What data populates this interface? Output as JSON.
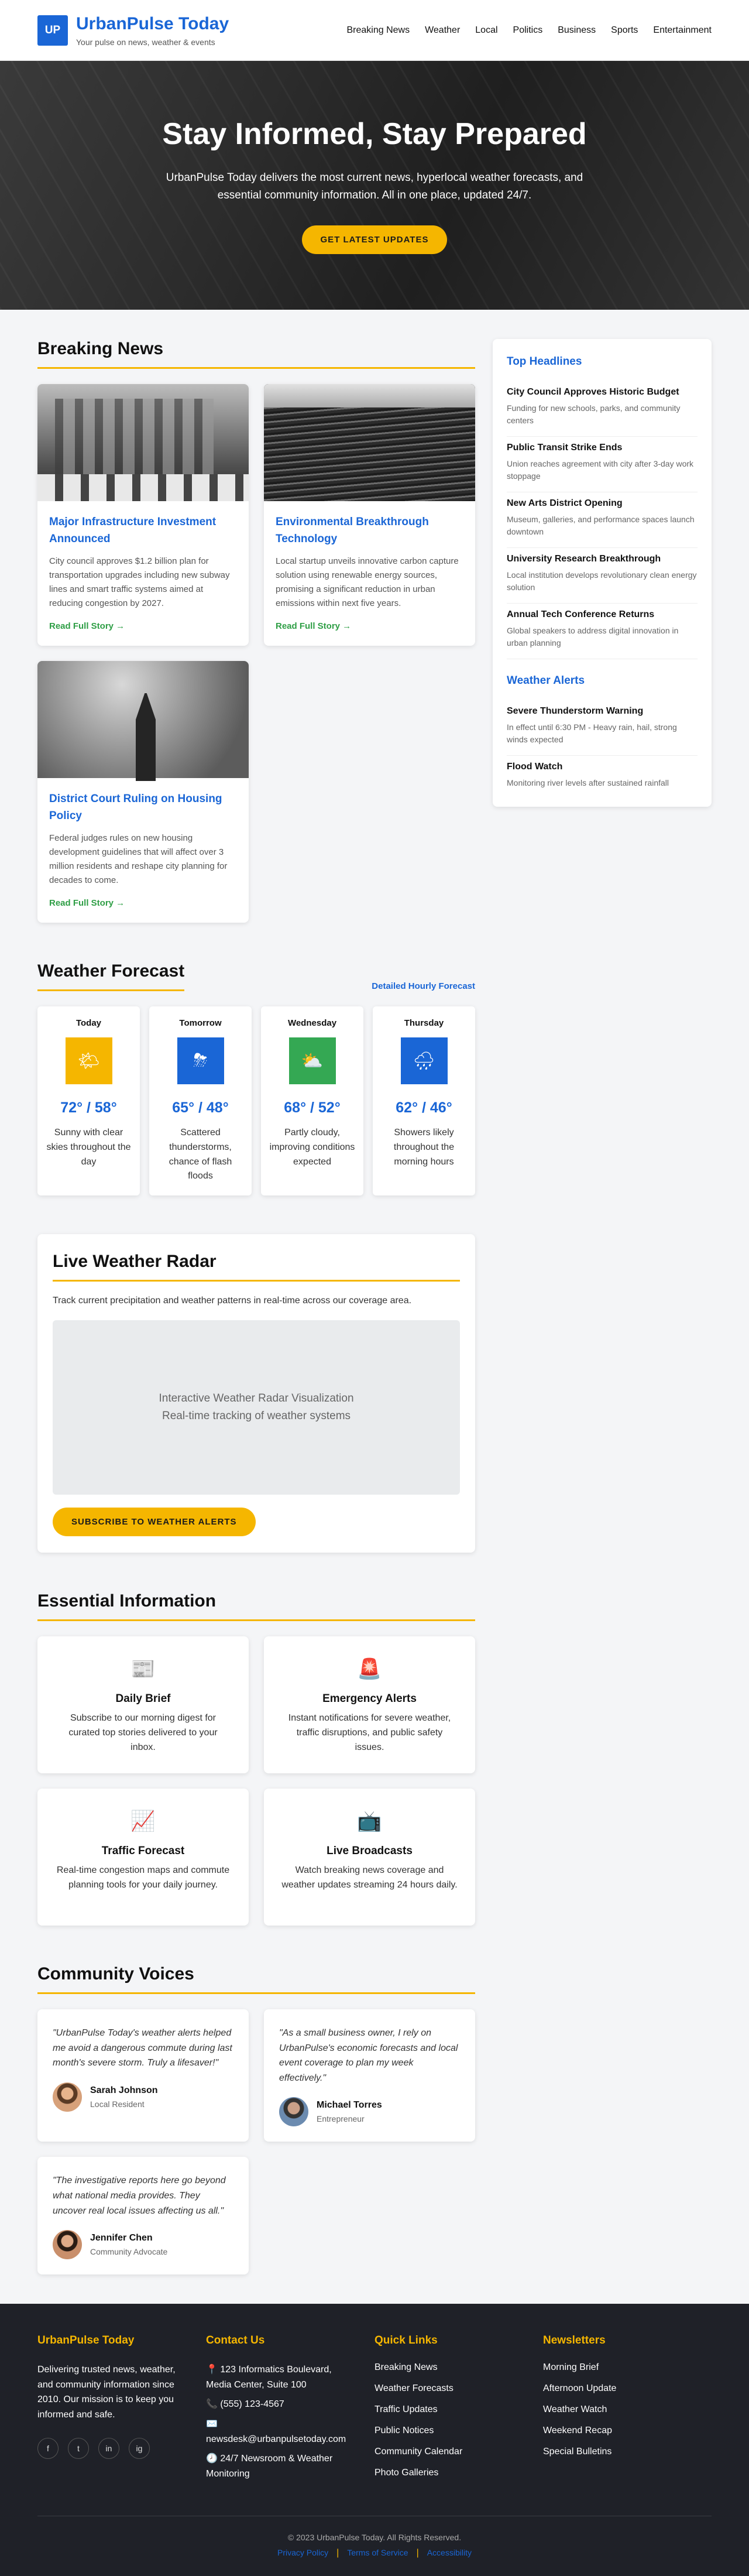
{
  "header": {
    "logo": "UP",
    "brand": "UrbanPulse Today",
    "tagline": "Your pulse on news, weather & events",
    "nav": [
      "Breaking News",
      "Weather",
      "Local",
      "Politics",
      "Business",
      "Sports",
      "Entertainment"
    ]
  },
  "hero": {
    "title": "Stay Informed, Stay Prepared",
    "subtitle": "UrbanPulse Today delivers the most current news, hyperlocal weather forecasts, and essential community information. All in one place, updated 24/7.",
    "cta": "Get Latest Updates"
  },
  "breaking": {
    "title": "Breaking News",
    "stories": [
      {
        "title": "Major Infrastructure Investment Announced",
        "text": "City council approves $1.2 billion plan for transportation upgrades including new subway lines and smart traffic systems aimed at reducing congestion by 2027.",
        "link": "Read Full Story →"
      },
      {
        "title": "Environmental Breakthrough Technology",
        "text": "Local startup unveils innovative carbon capture solution using renewable energy sources, promising a significant reduction in urban emissions within next five years.",
        "link": "Read Full Story →"
      },
      {
        "title": "District Court Ruling on Housing Policy",
        "text": "Federal judges rules on new housing development guidelines that will affect over 3 million residents and reshape city planning for decades to come.",
        "link": "Read Full Story →"
      }
    ]
  },
  "sidebar": {
    "headlines_title": "Top Headlines",
    "headlines": [
      {
        "title": "City Council Approves Historic Budget",
        "desc": "Funding for new schools, parks, and community centers"
      },
      {
        "title": "Public Transit Strike Ends",
        "desc": "Union reaches agreement with city after 3-day work stoppage"
      },
      {
        "title": "New Arts District Opening",
        "desc": "Museum, galleries, and performance spaces launch downtown"
      },
      {
        "title": "University Research Breakthrough",
        "desc": "Local institution develops revolutionary clean energy solution"
      },
      {
        "title": "Annual Tech Conference Returns",
        "desc": "Global speakers to address digital innovation in urban planning"
      }
    ],
    "alerts_title": "Weather Alerts",
    "alerts": [
      {
        "title": "Severe Thunderstorm Warning",
        "desc": "In effect until 6:30 PM - Heavy rain, hail, strong winds expected"
      },
      {
        "title": "Flood Watch",
        "desc": "Monitoring river levels after sustained rainfall"
      }
    ]
  },
  "weather": {
    "title": "Weather Forecast",
    "hourly_link": "Detailed Hourly Forecast",
    "days": [
      {
        "day": "Today",
        "icon": "🌤",
        "color": "#f5b600",
        "temp": "72° / 58°",
        "desc": "Sunny with clear skies throughout the day"
      },
      {
        "day": "Tomorrow",
        "icon": "⛈",
        "color": "#1a66d6",
        "temp": "65° / 48°",
        "desc": "Scattered thunderstorms, chance of flash floods"
      },
      {
        "day": "Wednesday",
        "icon": "⛅",
        "color": "#34a853",
        "temp": "68° / 52°",
        "desc": "Partly cloudy, improving conditions expected"
      },
      {
        "day": "Thursday",
        "icon": "🌧",
        "color": "#1a66d6",
        "temp": "62° / 46°",
        "desc": "Showers likely throughout the morning hours"
      }
    ]
  },
  "radar": {
    "title": "Live Weather Radar",
    "intro": "Track current precipitation and weather patterns in real-time across our coverage area.",
    "box_line1": "Interactive Weather Radar Visualization",
    "box_line2": "Real-time tracking of weather systems",
    "cta": "Subscribe to Weather Alerts"
  },
  "essential": {
    "title": "Essential Information",
    "items": [
      {
        "icon": "📰",
        "title": "Daily Brief",
        "desc": "Subscribe to our morning digest for curated top stories delivered to your inbox."
      },
      {
        "icon": "🚨",
        "title": "Emergency Alerts",
        "desc": "Instant notifications for severe weather, traffic disruptions, and public safety issues."
      },
      {
        "icon": "📈",
        "title": "Traffic Forecast",
        "desc": "Real-time congestion maps and commute planning tools for your daily journey."
      },
      {
        "icon": "📺",
        "title": "Live Broadcasts",
        "desc": "Watch breaking news coverage and weather updates streaming 24 hours daily."
      }
    ]
  },
  "community": {
    "title": "Community Voices",
    "items": [
      {
        "quote": "\"UrbanPulse Today's weather alerts helped me avoid a dangerous commute during last month's severe storm. Truly a lifesaver!\"",
        "name": "Sarah Johnson",
        "role": "Local Resident"
      },
      {
        "quote": "\"As a small business owner, I rely on UrbanPulse's economic forecasts and local event coverage to plan my week effectively.\"",
        "name": "Michael Torres",
        "role": "Entrepreneur"
      },
      {
        "quote": "\"The investigative reports here go beyond what national media provides. They uncover real local issues affecting us all.\"",
        "name": "Jennifer Chen",
        "role": "Community Advocate"
      }
    ]
  },
  "footer": {
    "about_title": "UrbanPulse Today",
    "about_text": "Delivering trusted news, weather, and community information since 2010. Our mission is to keep you informed and safe.",
    "socials": [
      "f",
      "t",
      "in",
      "ig"
    ],
    "contact_title": "Contact Us",
    "contact": [
      "📍 123 Informatics Boulevard, Media Center, Suite 100",
      "📞 (555) 123-4567",
      "✉️ newsdesk@urbanpulsetoday.com",
      "🕗 24/7 Newsroom & Weather Monitoring"
    ],
    "quick_title": "Quick Links",
    "quick_links": [
      "Breaking News",
      "Weather Forecasts",
      "Traffic Updates",
      "Public Notices",
      "Community Calendar",
      "Photo Galleries"
    ],
    "news_title": "Newsletters",
    "newsletters": [
      "Morning Brief",
      "Afternoon Update",
      "Weather Watch",
      "Weekend Recap",
      "Special Bulletins"
    ],
    "copyright": "© 2023 UrbanPulse Today. All Rights Reserved.",
    "legal": [
      "Privacy Policy",
      "Terms of Service",
      "Accessibility"
    ]
  }
}
